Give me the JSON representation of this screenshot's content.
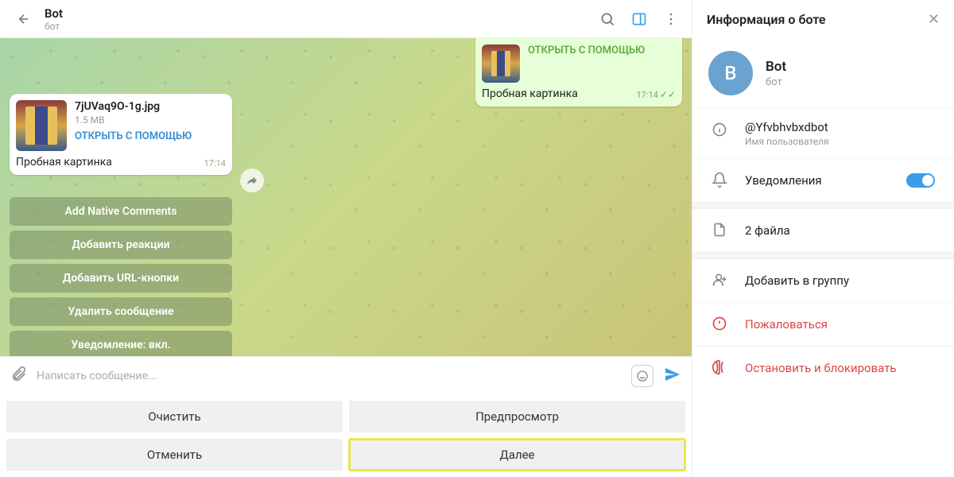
{
  "header": {
    "name": "Bot",
    "subtitle": "бот"
  },
  "out_msg": {
    "open_with": "ОТКРЫТЬ С ПОМОЩЬЮ",
    "caption": "Пробная картинка",
    "time": "17:14"
  },
  "in_msg": {
    "filename": "7jUVaq9O-1g.jpg",
    "filesize": "1.5 MB",
    "open_with": "ОТКРЫТЬ С ПОМОЩЬЮ",
    "caption": "Пробная картинка",
    "time": "17:14"
  },
  "inline_buttons": [
    "Add Native Comments",
    "Добавить реакции",
    "Добавить URL-кнопки",
    "Удалить сообщение",
    "Уведомление: вкл."
  ],
  "compose": {
    "placeholder": "Написать сообщение..."
  },
  "bottom": {
    "clear": "Очистить",
    "preview": "Предпросмотр",
    "cancel": "Отменить",
    "next": "Далее"
  },
  "sidebar": {
    "title": "Информация о боте",
    "avatar_letter": "B",
    "name": "Bot",
    "subtitle": "бот",
    "username": "@Yfvbhvbxdbot",
    "username_label": "Имя пользователя",
    "notifications": "Уведомления",
    "files": "2 файла",
    "add_group": "Добавить в группу",
    "report": "Пожаловаться",
    "stop_block": "Остановить и блокировать"
  }
}
